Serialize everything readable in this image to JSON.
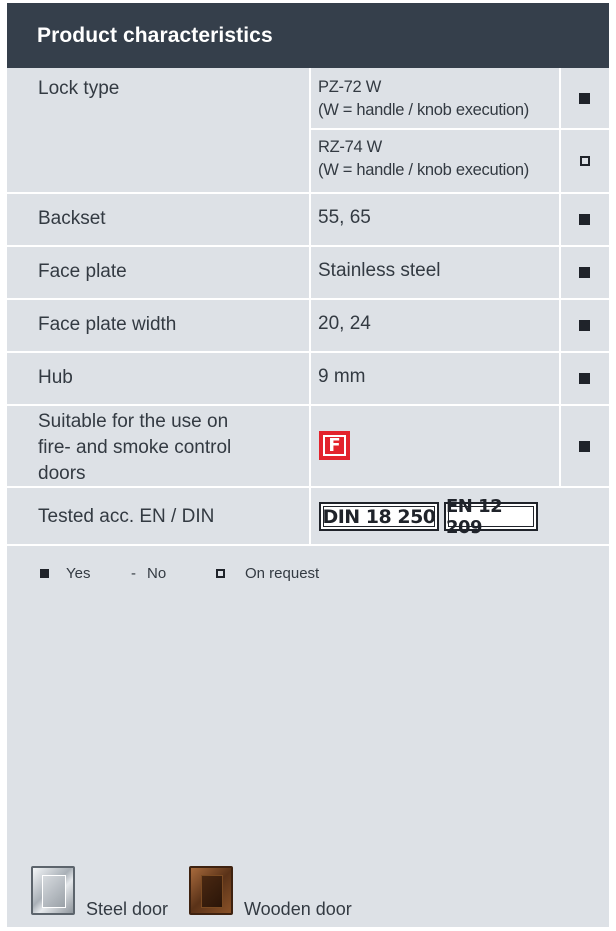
{
  "header": {
    "title": "Product characteristics"
  },
  "rows": {
    "lock_type": {
      "label": "Lock type",
      "options": [
        {
          "model": "PZ-72 W",
          "note": "(W = handle / knob execution)",
          "mark": "yes"
        },
        {
          "model": "RZ-74 W",
          "note": "(W = handle / knob execution)",
          "mark": "on-request"
        }
      ]
    },
    "backset": {
      "label": "Backset",
      "value": "55, 65",
      "mark": "yes"
    },
    "face_plate": {
      "label": "Face plate",
      "value": "Stainless steel",
      "mark": "yes"
    },
    "face_plate_width": {
      "label": "Face plate width",
      "value": "20, 24",
      "mark": "yes"
    },
    "hub": {
      "label": "Hub",
      "value": "9 mm",
      "mark": "yes"
    },
    "fire": {
      "label_lines": [
        "Suitable for the use on",
        "fire- and smoke control",
        "doors"
      ],
      "badge": "F",
      "mark": "yes"
    },
    "tested": {
      "label": "Tested acc. EN / DIN",
      "standards": [
        "DIN 18 250",
        "EN 12 209"
      ]
    }
  },
  "legend": {
    "yes": "Yes",
    "no_symbol": "-",
    "no": "No",
    "on_request": "On request"
  },
  "doors": {
    "steel": {
      "label": "Steel door",
      "icon": "steel-door-icon"
    },
    "wooden": {
      "label": "Wooden door",
      "icon": "wooden-door-icon"
    }
  },
  "colors": {
    "header_bg": "#353f4b",
    "panel_bg": "#dde1e6",
    "fire_badge": "#e3232c"
  }
}
